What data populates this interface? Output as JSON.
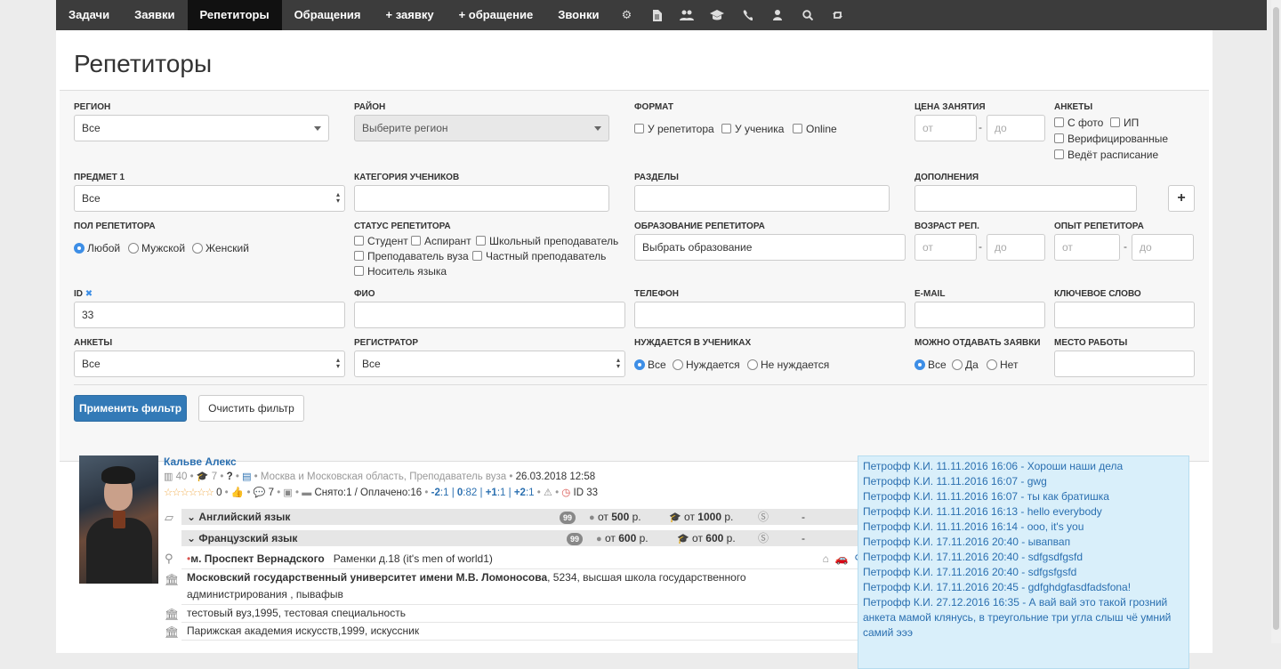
{
  "nav": {
    "items": [
      "Задачи",
      "Заявки",
      "Репетиторы",
      "Обращения",
      "+ заявку",
      "+ обращение",
      "Звонки"
    ],
    "active": "Репетиторы",
    "icons": [
      "gears-icon",
      "document-icon",
      "users-icon",
      "graduation-cap-icon",
      "phone-icon",
      "user-icon",
      "search-icon",
      "retweet-icon"
    ]
  },
  "page": {
    "title": "Репетиторы"
  },
  "filters": {
    "region": {
      "label": "РЕГИОН",
      "value": "Все"
    },
    "district": {
      "label": "РАЙОН",
      "value": "Выберите регион"
    },
    "format": {
      "label": "ФОРМАТ",
      "options": [
        "У репетитора",
        "У ученика",
        "Online"
      ]
    },
    "price": {
      "label": "ЦЕНА ЗАНЯТИЯ",
      "from": "от",
      "to": "до",
      "dash": "-"
    },
    "profiles": {
      "label": "АНКЕТЫ",
      "options": [
        "С фото",
        "ИП",
        "Верифицированные",
        "Ведёт расписание"
      ]
    },
    "subject": {
      "label": "ПРЕДМЕТ 1",
      "value": "Все"
    },
    "student_category": {
      "label": "КАТЕГОРИЯ УЧЕНИКОВ"
    },
    "sections": {
      "label": "РАЗДЕЛЫ"
    },
    "additions": {
      "label": "ДОПОЛНЕНИЯ",
      "add_button": "+"
    },
    "gender": {
      "label": "ПОЛ РЕПЕТИТОРА",
      "options": [
        "Любой",
        "Мужской",
        "Женский"
      ],
      "selected": "Любой"
    },
    "status": {
      "label": "СТАТУС РЕПЕТИТОРА",
      "options": [
        "Студент",
        "Аспирант",
        "Школьный преподаватель",
        "Преподаватель вуза",
        "Частный преподаватель",
        "Носитель языка"
      ]
    },
    "education": {
      "label": "ОБРАЗОВАНИЕ РЕПЕТИТОРА",
      "value": "Выбрать образование"
    },
    "age": {
      "label": "ВОЗРАСТ РЕП.",
      "from": "от",
      "to": "до"
    },
    "experience": {
      "label": "ОПЫТ РЕПЕТИТОРА",
      "from": "от",
      "to": "до"
    },
    "id": {
      "label": "ID",
      "clear": "✖",
      "value": "33"
    },
    "fio": {
      "label": "ФИО"
    },
    "phone": {
      "label": "ТЕЛЕФОН"
    },
    "email": {
      "label": "E-MAIL"
    },
    "keyword": {
      "label": "КЛЮЧЕВОЕ СЛОВО"
    },
    "profiles2": {
      "label": "АНКЕТЫ",
      "value": "Все"
    },
    "registrar": {
      "label": "РЕГИСТРАТОР",
      "value": "Все"
    },
    "needs_students": {
      "label": "НУЖДАЕТСЯ В УЧЕНИКАХ",
      "options": [
        "Все",
        "Нуждается",
        "Не нуждается"
      ],
      "selected": "Все"
    },
    "can_give": {
      "label": "МОЖНО ОТДАВАТЬ ЗАЯВКИ",
      "options": [
        "Все",
        "Да",
        "Нет"
      ],
      "selected": "Все"
    },
    "workplace": {
      "label": "МЕСТО РАБОТЫ"
    },
    "apply": "Применить фильтр",
    "clear": "Очистить фильтр"
  },
  "tutor": {
    "name": "Кальве Алекс",
    "stats1": {
      "a": "40",
      "b": "7",
      "c": "?",
      "location": "Москва и Московская область, Преподаватель вуза",
      "date": "26.03.2018 12:58"
    },
    "stats2": {
      "stars": "☆☆☆☆☆☆",
      "likes": "0",
      "comments": "7",
      "taken": "Снято:1 / Оплачено:16",
      "s1": "-2",
      "s1b": ":1",
      "s2": "0",
      "s2b": ":82",
      "s3": "+1",
      "s3b": ":1",
      "s4": "+2",
      "s4b": ":1",
      "id": "ID 33"
    },
    "subjects": [
      {
        "name": "Английский язык",
        "badge": "99",
        "price1": "от 500 р.",
        "price1_label": "от",
        "price1_val": "500",
        "price1_cur": "р.",
        "price2_label": "от",
        "price2_val": "1000",
        "price2_cur": "р.",
        "dash": "-"
      },
      {
        "name": "Французский язык",
        "badge": "99",
        "price1_label": "от",
        "price1_val": "600",
        "price1_cur": "р.",
        "price2_label": "от",
        "price2_val": "600",
        "price2_cur": "р.",
        "dash": "-"
      }
    ],
    "metro": "м. Проспект Вернадского",
    "address": "Раменки д.18 (it's men of world1)",
    "edu1_bold": "Московский государственный университет имени М.В. Ломоносова",
    "edu1_rest": ", 5234, высшая школа государственного",
    "edu1_line2": "администрирования , пывафыв",
    "edu2": "тестовый вуз,1995, тестовая специальность",
    "edu3": "Парижская академия искусств,1999, искусcник"
  },
  "chat": [
    "Петрофф К.И. 11.11.2016 16:06 - Хороши наши дела",
    "Петрофф К.И. 11.11.2016 16:07 - gwg",
    "Петрофф К.И. 11.11.2016 16:07 - ты как братишка",
    "Петрофф К.И. 11.11.2016 16:13 - hello everybody",
    "Петрофф К.И. 11.11.2016 16:14 - ooo, it's you",
    "Петрофф К.И. 17.11.2016 20:40 - ывапвап",
    "Петрофф К.И. 17.11.2016 20:40 - sdfgsdfgsfd",
    "Петрофф К.И. 17.11.2016 20:40 - sdfgsfgsfd",
    "Петрофф К.И. 17.11.2016 20:45 - gdfghdgfasdfadsfona!",
    "Петрофф К.И. 27.12.2016 16:35 - А вай вай это такой грозний",
    "анкета мамой клянусь, в треугольние три угла слыш чё умний",
    "самий эээ"
  ]
}
